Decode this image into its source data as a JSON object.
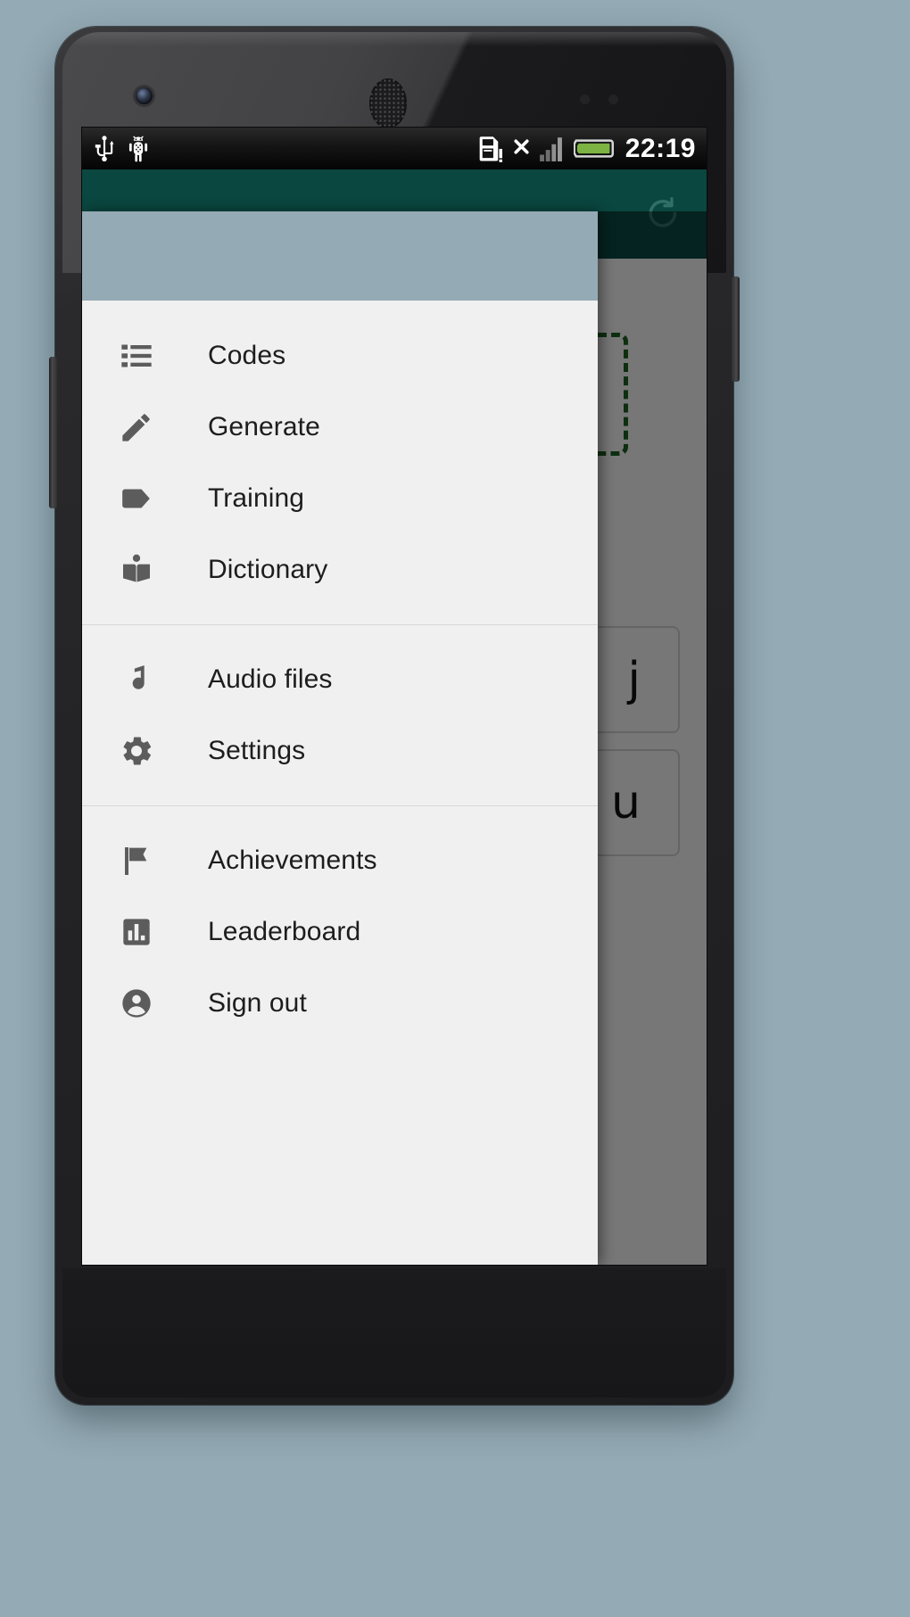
{
  "device": {
    "type": "android-phone-mockup",
    "front_camera": "camera-icon",
    "earpiece": "speaker-grille-icon"
  },
  "statusbar": {
    "time": "22:19",
    "left_icons": [
      {
        "name": "usb-icon",
        "label": "USB connected"
      },
      {
        "name": "android-debug-icon",
        "label": "USB debugging connected"
      }
    ],
    "right_icons": [
      {
        "name": "sd-card-warning-icon",
        "label": "SD card"
      },
      {
        "name": "no-sim-icon",
        "label": "No SIM"
      },
      {
        "name": "signal-bars-icon",
        "label": "Signal"
      },
      {
        "name": "battery-icon",
        "label": "Battery"
      }
    ],
    "background_color": "#141414",
    "text_color": "#ffffff",
    "battery_color": "#7cb342"
  },
  "app": {
    "actionbar": {
      "background_color": "#0a4740",
      "refresh_label": "Refresh",
      "refresh_icon": "refresh-icon"
    },
    "content": {
      "background_color": "#efefef",
      "dashed_box": {
        "name": "drop-target-dashed-box",
        "border_color": "#1b5e20",
        "style": "dashed"
      },
      "cards": [
        {
          "glyph": "j"
        },
        {
          "glyph": "u"
        }
      ]
    }
  },
  "drawer": {
    "background_color": "#f0f0f0",
    "header_color": "#94aab4",
    "scrim_color": "rgba(0,0,0,0.50)",
    "groups": [
      {
        "items": [
          {
            "label": "Codes",
            "icon": "list-icon"
          },
          {
            "label": "Generate",
            "icon": "pencil-icon"
          },
          {
            "label": "Training",
            "icon": "tag-icon"
          },
          {
            "label": "Dictionary",
            "icon": "book-icon"
          }
        ]
      },
      {
        "items": [
          {
            "label": "Audio files",
            "icon": "music-note-icon"
          },
          {
            "label": "Settings",
            "icon": "gear-icon"
          }
        ]
      },
      {
        "items": [
          {
            "label": "Achievements",
            "icon": "flag-icon"
          },
          {
            "label": "Leaderboard",
            "icon": "bar-chart-icon"
          },
          {
            "label": "Sign out",
            "icon": "account-circle-icon"
          }
        ]
      }
    ]
  }
}
